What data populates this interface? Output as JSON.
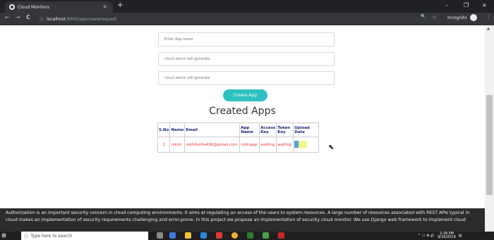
{
  "browser": {
    "tab_title": "Cloud Monitors",
    "tab_close": "×",
    "new_tab": "+",
    "url_host": "localhost",
    "url_path": ":8000/appcreaterequest",
    "nav_back": "←",
    "nav_forward": "→",
    "nav_reload": "C",
    "info_icon": "ⓘ",
    "incognito_label": "Incognito",
    "minimize": "–",
    "maximize": "❐",
    "close": "×",
    "star": "☆",
    "search": "🔍",
    "menu": "⋮"
  },
  "form": {
    "app_name_placeholder": "Enter App name",
    "field2_placeholder": "cloud admin will generate",
    "field3_placeholder": "cloud admin will generate",
    "create_button": "Create App"
  },
  "heading": "Created Apps",
  "table": {
    "headers": [
      "S.No",
      "Name",
      "Email",
      "App Name",
      "Access Key",
      "Token Key",
      "Upload Data"
    ],
    "rows": [
      [
        "1",
        "nikhil",
        "nikhilkotta496@gmail.com",
        "nikkiapp",
        "waiting",
        "waiting",
        ""
      ]
    ]
  },
  "footer_text": "Authorization is an important security concern in cloud computing environments. It aims at regulating an access of the users to system resources. A large number of resources associated with REST APIs typical in cloud makes an implementation of security requirements challenging and error-prone. In this project we propose an implementation of security cloud monitor. We use Django web framework to implement cloud",
  "taskbar": {
    "search_placeholder": "Type here to search",
    "time": "2:18 PM",
    "date": "9/16/2019"
  },
  "colors": {
    "accent": "#2ebfbf",
    "header_text": "#1a237e",
    "cell_text": "#e53935"
  }
}
